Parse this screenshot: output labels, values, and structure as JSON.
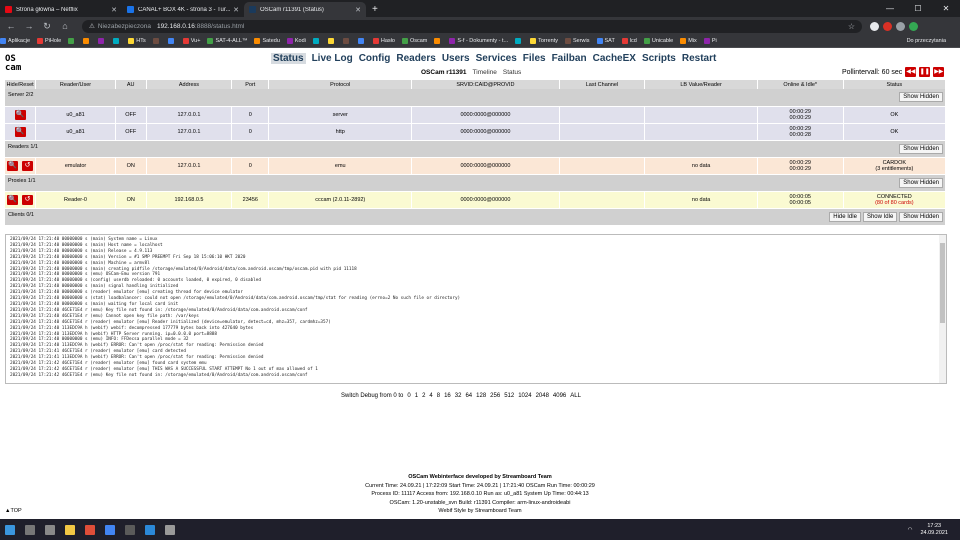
{
  "browser": {
    "tabs": [
      {
        "title": "Strona główna – Netflix",
        "color": "#e50914"
      },
      {
        "title": "CANAL+ BOX 4K - strona 3 - Tur...",
        "color": "#1a73e8"
      },
      {
        "title": "OSCam r11391 (Status)",
        "color": "#1a3a5c",
        "active": true
      }
    ],
    "url_warning": "Niezabezpieczona",
    "url_host": "192.168.0.16",
    "url_path": ":8888/status.html",
    "bookmarks": [
      "Aplikacje",
      "PiHole",
      "",
      "",
      "",
      "",
      "HTs",
      "",
      "",
      "Vu+",
      "SAT-4-ALL™",
      "Satedu",
      "Kodi",
      "",
      "",
      "",
      "",
      "Hasło",
      "Oscam",
      "",
      "S-f - Dokumenty - t...",
      "",
      "Torrenty",
      "Serwis",
      "SAT",
      "lcd",
      "Unicable",
      "Mix",
      "Pi"
    ],
    "bookmarks_right": "Do przeczytania"
  },
  "oscam": {
    "logo_line1": "OS",
    "logo_line2": "cam",
    "menu": [
      "Status",
      "Live Log",
      "Config",
      "Readers",
      "Users",
      "Services",
      "Files",
      "Failban",
      "CacheEX",
      "Scripts",
      "Restart"
    ],
    "subtitle_title": "OSCam r11391",
    "subtitle_timeline": "Timeline",
    "subtitle_status": "Status",
    "poll_label": "Pollintervall: 60 sec",
    "headers": [
      "Hide/Reset",
      "Reader/User",
      "AU",
      "Address",
      "Port",
      "Protocol",
      "SRVID:CAID@PROVID",
      "Last Channel",
      "LB Value/Reader",
      "Online & Idle*",
      "Status"
    ],
    "server_section": "Server 2/2",
    "show_hidden": "Show Hidden",
    "servers": [
      {
        "user": "u0_a81",
        "au": "OFF",
        "address": "127.0.0.1",
        "port": "0",
        "protocol": "server",
        "srvid": "0000:0000@000000",
        "last": "",
        "lb": "",
        "online": "00:00:29",
        "idle": "00:00:29",
        "status": "OK"
      },
      {
        "user": "u0_a81",
        "au": "OFF",
        "address": "127.0.0.1",
        "port": "0",
        "protocol": "http",
        "srvid": "0000:0000@000000",
        "last": "",
        "lb": "",
        "online": "00:00:29",
        "idle": "00:00:28",
        "status": "OK"
      }
    ],
    "readers_section": "Readers 1/1",
    "reader": {
      "user": "emulator",
      "au": "ON",
      "address": "127.0.0.1",
      "port": "0",
      "protocol": "emu",
      "srvid": "0000:0000@000000",
      "last": "",
      "lb": "no data",
      "online": "00:00:29",
      "idle": "00:00:29",
      "status": "CARDOK",
      "status2": "(3 entitlements)"
    },
    "proxies_section": "Proxies 1/1",
    "proxy": {
      "user": "Reader-0",
      "au": "ON",
      "address": "192.168.0.5",
      "port": "23456",
      "protocol": "cccam (2.0.11-2892)",
      "srvid": "0000:0000@000000",
      "last": "",
      "lb": "no data",
      "online": "00:00:05",
      "idle": "00:00:05",
      "status": "CONNECTED",
      "status2": "(80 of 80 cards)"
    },
    "clients_section": "Clients 0/1",
    "hide_idle": "Hide Idle",
    "show_idle": "Show Idle",
    "log": [
      "2021/09/24 17:21:40 00000000 s (main) System name = Linux",
      "2021/09/24 17:21:40 00000000 s (main) Host name = localhost",
      "2021/09/24 17:21:40 00000000 s (main) Release = 4.9.113",
      "2021/09/24 17:21:40 00000000 s (main) Version = #1 SMP PREEMPT Fri Sep 18 15:06:10 HKT 2020",
      "2021/09/24 17:21:40 00000000 s (main) Machine = armv8l",
      "2021/09/24 17:21:40 00000000 s (main) creating pidfile /storage/emulated/0/Android/data/com.android.oscam/tmp/oscam.pid with pid 11118",
      "2021/09/24 17:21:40 00000000 s (emu) OSCam-Emu version 791",
      "2021/09/24 17:21:40 00000000 s (config) userdb reloaded: 0 accounts loaded, 0 expired, 0 disabled",
      "2021/09/24 17:21:40 00000000 s (main) signal handling initialized",
      "2021/09/24 17:21:40 00000000 s (reader) emulator [emu] creating thread for device emulator",
      "2021/09/24 17:21:40 00000000 s (stat) loadbalancer: could not open /storage/emulated/0/Android/data/com.android.oscam/tmp/stat for reading (errno=2 No such file or directory)",
      "2021/09/24 17:21:40 00000000 s (main) waiting for local card init",
      "2021/09/24 17:21:40 46CE71E4 r (emu) Key file not found in: /storage/emulated/0/Android/data/com.android.oscam/conf",
      "2021/09/24 17:21:40 46CE71E4 r (emu) Cannot open key file path: /var/keys",
      "2021/09/24 17:21:40 46CE71E4 r (reader) emulator [emu] Reader initialized (device=emulator, detect=cd, mhz=357, cardmhz=357)",
      "2021/09/24 17:21:40 113EDC9A h (webif) webif: decompressed 177779 bytes back into 427640 bytes",
      "2021/09/24 17:21:40 113EDC9A h (webif) HTTP Server running. ip=0.0.0.0 port=8888",
      "2021/09/24 17:21:40 00000000 s (emu) INFO: FFDecsa parallel mode = 32",
      "2021/09/24 17:21:40 113EDC9A h (webif) ERROR: Can't open /proc/stat for reading: Permission denied",
      "2021/09/24 17:21:41 46CE71E4 r (reader) emulator [emu] card detected",
      "2021/09/24 17:21:41 113EDC9A h (webif) ERROR: Can't open /proc/stat for reading: Permission denied",
      "2021/09/24 17:21:42 46CE71E4 r (reader) emulator [emu] found card system emu",
      "2021/09/24 17:21:42 46CE71E4 r (reader) emulator [emu] THIS WAS A SUCCESSFUL START ATTEMPT No 1 out of max allowed of 1",
      "2021/09/24 17:21:42 46CE71E4 r (emu) Key file not found in: /storage/emulated/0/Android/data/com.android.oscam/conf"
    ],
    "debug_label": "Switch Debug from 0 to",
    "debug_levels": [
      "0",
      "1",
      "2",
      "4",
      "8",
      "16",
      "32",
      "64",
      "128",
      "256",
      "512",
      "1024",
      "2048",
      "4096",
      "ALL"
    ],
    "footer_title": "OSCam Webinterface developed by Streamboard Team",
    "footer_line1": "Current Time: 24.09.21 | 17:22:09 Start Time: 24.09.21 | 17:21:40 OSCam Run Time: 00:00:29",
    "footer_line2": "Process ID: 11117 Access from: 192.168.0.10 Run as: u0_a81 System Up Time: 00:44:13",
    "footer_line3": "OSCam: 1.20-unstable_svn Build: r11391 Compiler: arm-linux-androideabi",
    "footer_line4": "Webif Style by Streamboard Team",
    "totop": "▲TOP"
  },
  "taskbar": {
    "time": "17:23",
    "date": "24.09.2021"
  }
}
